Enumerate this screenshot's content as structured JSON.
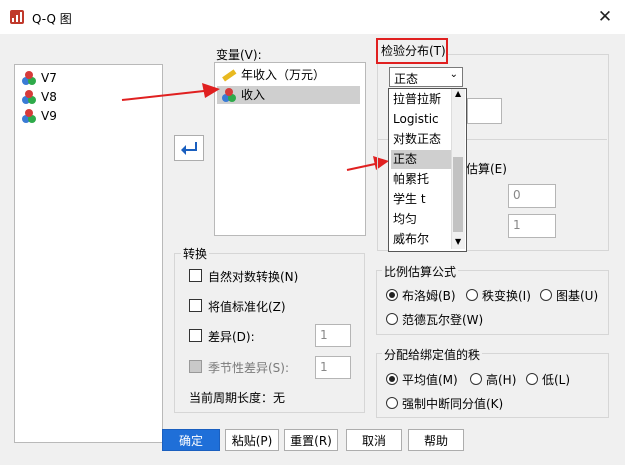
{
  "window": {
    "title": "Q-Q 图",
    "close": "✕"
  },
  "source_list": {
    "items": [
      "V7",
      "V8",
      "V9"
    ]
  },
  "variables": {
    "label": "变量(V):",
    "items": [
      {
        "label": "年收入（万元）",
        "icon": "ruler-icon"
      },
      {
        "label": "收入",
        "icon": "nominal-balls-icon",
        "selected": true
      }
    ]
  },
  "distribution": {
    "label": "检验分布(T)",
    "selected": "正态",
    "options": [
      "拉普拉斯",
      "Logistic",
      "对数正态",
      "正态",
      "帕累托",
      "学生 t",
      "均匀",
      "威布尔"
    ],
    "partial_label": "估算(E)",
    "field1": "0",
    "field2": "1"
  },
  "transform": {
    "label": "转换",
    "natural_log": "自然对数转换(N)",
    "standardize": "将值标准化(Z)",
    "difference": "差异(D):",
    "difference_value": "1",
    "seasonal": "季节性差异(S):",
    "seasonal_value": "1",
    "period_label": "当前周期长度：无"
  },
  "proportion": {
    "label": "比例估算公式",
    "options": [
      {
        "label": "布洛姆(B)",
        "checked": true
      },
      {
        "label": "秩变换(I)",
        "checked": false
      },
      {
        "label": "图基(U)",
        "checked": false
      },
      {
        "label": "范德瓦尔登(W)",
        "checked": false
      }
    ]
  },
  "ties": {
    "label": "分配给绑定值的秩",
    "options": [
      {
        "label": "平均值(M)",
        "checked": true
      },
      {
        "label": "高(H)",
        "checked": false
      },
      {
        "label": "低(L)",
        "checked": false
      },
      {
        "label": "强制中断同分值(K)",
        "checked": false
      }
    ]
  },
  "buttons": {
    "ok": "确定",
    "paste": "粘贴(P)",
    "reset": "重置(R)",
    "cancel": "取消",
    "help": "帮助"
  },
  "annotation_color": "#e02020"
}
